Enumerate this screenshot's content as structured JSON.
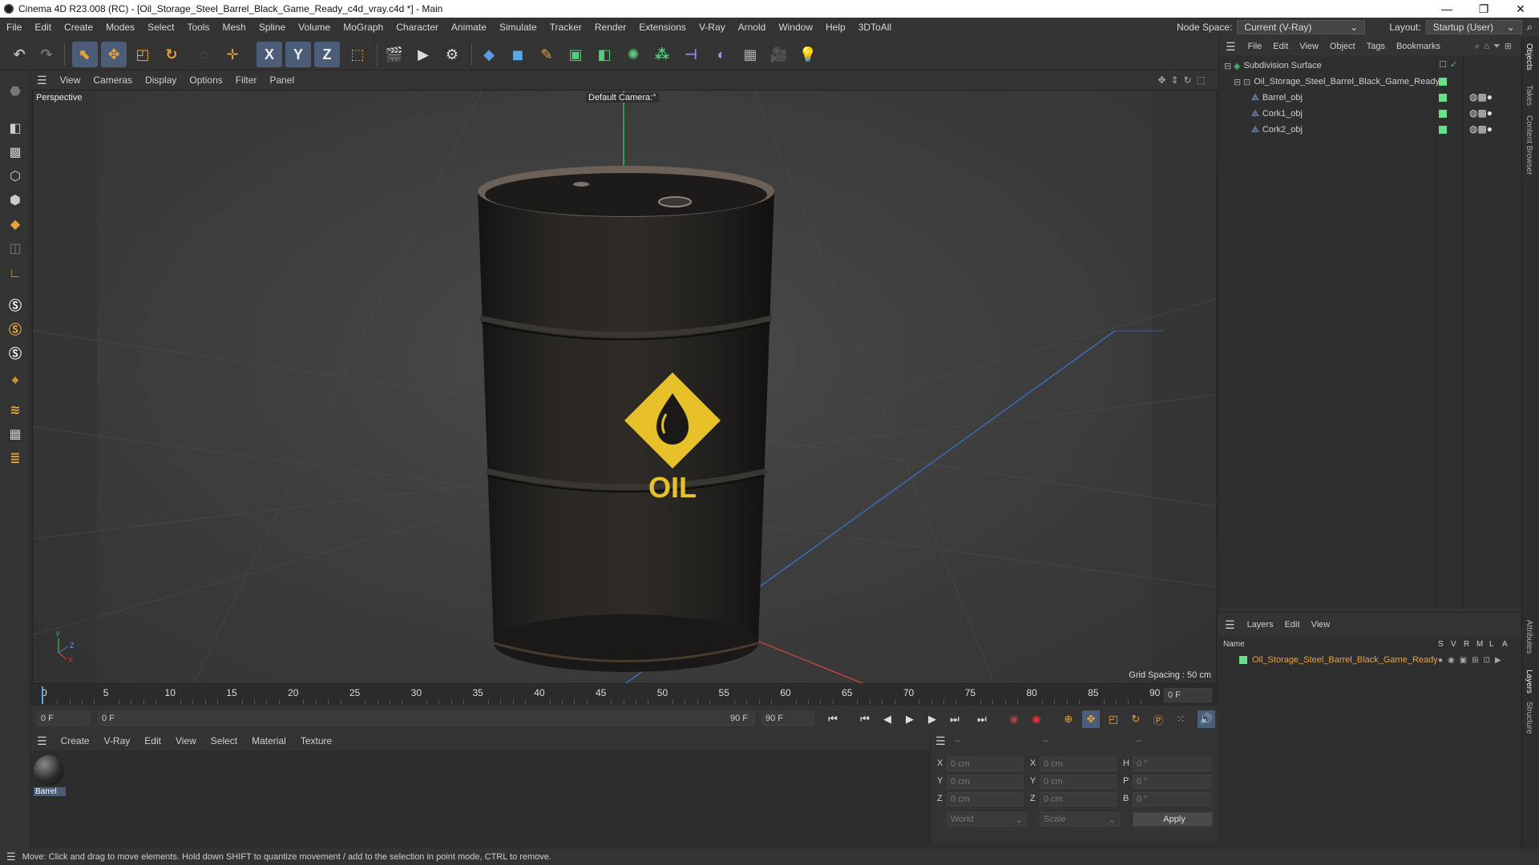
{
  "window": {
    "title": "Cinema 4D R23.008 (RC) - [Oil_Storage_Steel_Barrel_Black_Game_Ready_c4d_vray.c4d *] - Main",
    "minimize": "—",
    "maximize": "❐",
    "close": "✕"
  },
  "menubar": {
    "items": [
      "File",
      "Edit",
      "Create",
      "Modes",
      "Select",
      "Tools",
      "Mesh",
      "Spline",
      "Volume",
      "MoGraph",
      "Character",
      "Animate",
      "Simulate",
      "Tracker",
      "Render",
      "Extensions",
      "V-Ray",
      "Arnold",
      "Window",
      "Help",
      "3DToAll"
    ],
    "node_space_label": "Node Space:",
    "node_space_value": "Current (V-Ray)",
    "layout_label": "Layout:",
    "layout_value": "Startup (User)"
  },
  "toolbar": {
    "icons": [
      "undo-icon",
      "redo-icon",
      "select-icon",
      "move-icon",
      "scale-icon",
      "rotate-icon",
      "live-select-icon",
      "add-icon",
      "x-axis-icon",
      "y-axis-icon",
      "z-axis-icon",
      "coord-system-icon",
      "render-region-icon",
      "render-view-icon",
      "render-settings-icon",
      "python-icon",
      "cube-icon",
      "pen-icon",
      "subdivide-icon",
      "extrude-icon",
      "mograph-icon",
      "array-icon",
      "deformer-icon",
      "scene-icon",
      "grid-icon",
      "camera-icon",
      "light-icon"
    ],
    "x_label": "X",
    "y_label": "Y",
    "z_label": "Z"
  },
  "viewport_menu": {
    "items": [
      "View",
      "Cameras",
      "Display",
      "Options",
      "Filter",
      "Panel"
    ]
  },
  "viewport": {
    "name": "Perspective",
    "camera": "Default Camera",
    "camera_suffix": ":°",
    "grid_spacing": "Grid Spacing : 50 cm",
    "barrel_text": "OIL",
    "axis_y": "Y",
    "axis_z": "Z",
    "axis_x": "X"
  },
  "timeline": {
    "ticks": [
      "0",
      "5",
      "10",
      "15",
      "20",
      "25",
      "30",
      "35",
      "40",
      "45",
      "50",
      "55",
      "60",
      "65",
      "70",
      "75",
      "80",
      "85",
      "90"
    ],
    "current_frame": "0 F"
  },
  "transport": {
    "start_field": "0 F",
    "range_start": "0 F",
    "range_end": "90 F",
    "end_field": "90 F"
  },
  "material_bar": {
    "items": [
      "Create",
      "V-Ray",
      "Edit",
      "View",
      "Select",
      "Material",
      "Texture"
    ],
    "material_name": "Barrel"
  },
  "coords": {
    "header_a": "--",
    "header_b": "--",
    "header_c": "--",
    "x_label": "X",
    "y_label": "Y",
    "z_label": "Z",
    "h_label": "H",
    "p_label": "P",
    "b_label": "B",
    "pos_x": "0 cm",
    "pos_y": "0 cm",
    "pos_z": "0 cm",
    "size_x": "0 cm",
    "size_y": "0 cm",
    "size_z": "0 cm",
    "rot_h": "0 °",
    "rot_p": "0 °",
    "rot_b": "0 °",
    "world": "World",
    "scale": "Scale",
    "apply": "Apply"
  },
  "object_panel": {
    "menu": [
      "File",
      "Edit",
      "View",
      "Object",
      "Tags",
      "Bookmarks"
    ],
    "objects": [
      {
        "name": "Subdivision Surface"
      },
      {
        "name": "Oil_Storage_Steel_Barrel_Black_Game_Ready"
      },
      {
        "name": "Barrel_obj"
      },
      {
        "name": "Cork1_obj"
      },
      {
        "name": "Cork2_obj"
      }
    ]
  },
  "layer_panel": {
    "menu": [
      "Layers",
      "Edit",
      "View"
    ],
    "columns": [
      "Name",
      "S",
      "V",
      "R",
      "M",
      "L",
      "A"
    ],
    "layer_name": "Oil_Storage_Steel_Barrel_Black_Game_Ready"
  },
  "side_tabs": [
    "Objects",
    "Takes",
    "Content Browser",
    "Attributes",
    "Layers",
    "Structure"
  ],
  "status": {
    "text": "Move: Click and drag to move elements. Hold down SHIFT to quantize movement / add to the selection in point mode, CTRL to remove."
  },
  "colors": {
    "accent_blue": "#4b5d78",
    "layer_orange": "#e8a33a",
    "object_green": "#6adf8b",
    "oil_yellow": "#e6c12a"
  }
}
